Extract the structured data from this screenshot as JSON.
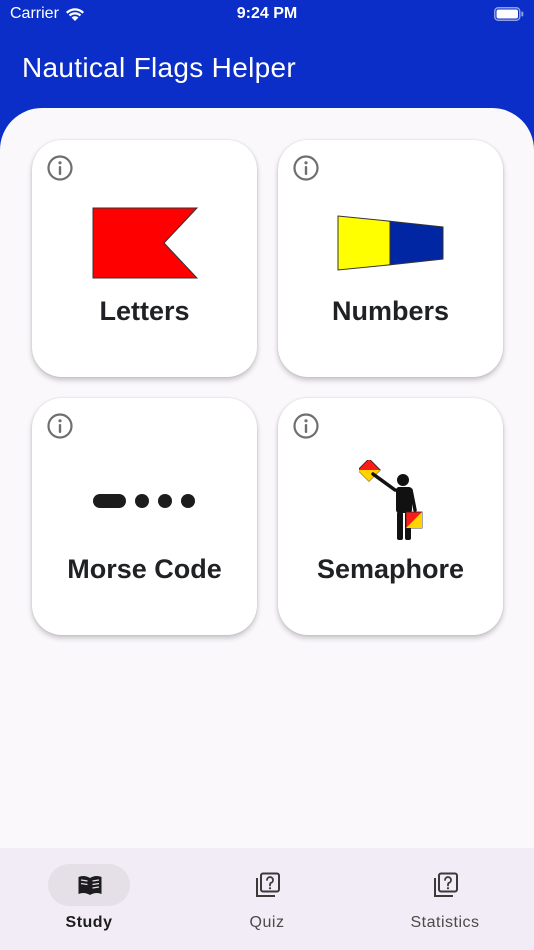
{
  "status_bar": {
    "carrier": "Carrier",
    "time": "9:24 PM"
  },
  "app": {
    "title": "Nautical Flags Helper"
  },
  "cards": [
    {
      "label": "Letters",
      "graphic": "flag-b-icon"
    },
    {
      "label": "Numbers",
      "graphic": "pennant-icon"
    },
    {
      "label": "Morse Code",
      "graphic": "morse-dots-icon"
    },
    {
      "label": "Semaphore",
      "graphic": "semaphore-figure-icon"
    }
  ],
  "bottom_nav": {
    "items": [
      {
        "label": "Study",
        "icon": "book-icon",
        "active": true
      },
      {
        "label": "Quiz",
        "icon": "quiz-icon",
        "active": false
      },
      {
        "label": "Statistics",
        "icon": "statistics-icon",
        "active": false
      }
    ]
  },
  "colors": {
    "header_blue": "#0a2ec7",
    "content_bg": "#fbf8fc",
    "nav_bg": "#f1ecf5",
    "flag_red": "#ff0000",
    "pennant_yellow": "#ffff00",
    "pennant_blue": "#0026a3"
  }
}
